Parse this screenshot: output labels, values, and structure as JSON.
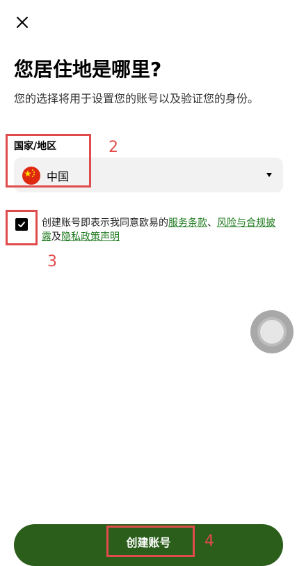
{
  "header": {
    "title": "您居住地是哪里?",
    "subtitle": "您的选择将用于设置您的账号以及验证您的身份。"
  },
  "country_field": {
    "label": "国家/地区",
    "value": "中国",
    "flag": "china-flag-icon"
  },
  "agreement": {
    "prefix": "创建账号即表示我同意欧易的",
    "terms_link": "服务条款",
    "sep1": "、",
    "risk_link": "风险与合规披露",
    "sep2": "及",
    "privacy_link": "隐私政策声明"
  },
  "create_button": {
    "label": "创建账号"
  },
  "annotations": {
    "n2": "2",
    "n3": "3",
    "n4": "4"
  },
  "colors": {
    "accent_green": "#2b5e1b",
    "link_green": "#1f7a1f",
    "annotation_red": "#e04b4b"
  }
}
